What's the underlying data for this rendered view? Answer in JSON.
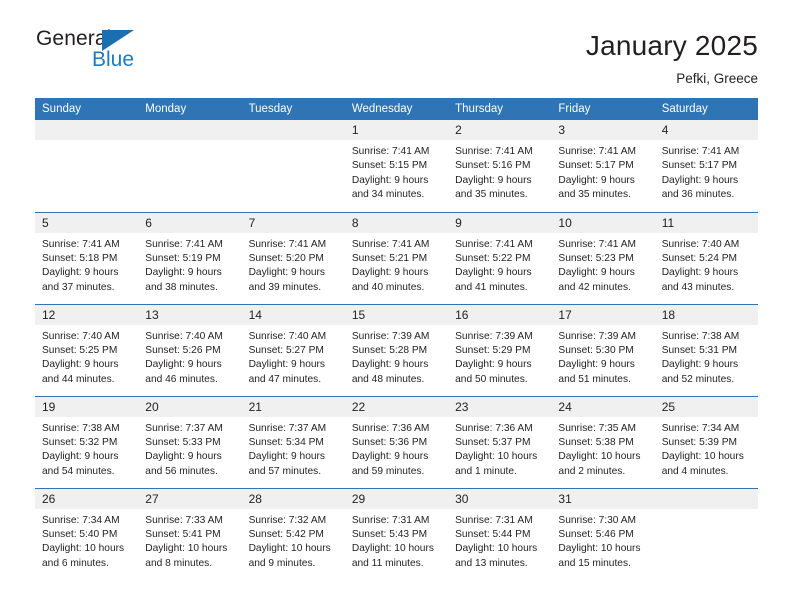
{
  "logo": {
    "word_dark": "General",
    "word_blue": "Blue",
    "triangle_icon": "triangle-icon"
  },
  "header": {
    "title": "January 2025",
    "location": "Pefki, Greece"
  },
  "colors": {
    "header_blue": "#2f74b5",
    "logo_blue": "#1a7dc4",
    "daynum_bg": "#f0f0f0",
    "text": "#231f20"
  },
  "calendar": {
    "weekday_headers": [
      "Sunday",
      "Monday",
      "Tuesday",
      "Wednesday",
      "Thursday",
      "Friday",
      "Saturday"
    ],
    "weeks": [
      [
        {
          "day": "",
          "lines": []
        },
        {
          "day": "",
          "lines": []
        },
        {
          "day": "",
          "lines": []
        },
        {
          "day": "1",
          "lines": [
            "Sunrise: 7:41 AM",
            "Sunset: 5:15 PM",
            "Daylight: 9 hours",
            "and 34 minutes."
          ]
        },
        {
          "day": "2",
          "lines": [
            "Sunrise: 7:41 AM",
            "Sunset: 5:16 PM",
            "Daylight: 9 hours",
            "and 35 minutes."
          ]
        },
        {
          "day": "3",
          "lines": [
            "Sunrise: 7:41 AM",
            "Sunset: 5:17 PM",
            "Daylight: 9 hours",
            "and 35 minutes."
          ]
        },
        {
          "day": "4",
          "lines": [
            "Sunrise: 7:41 AM",
            "Sunset: 5:17 PM",
            "Daylight: 9 hours",
            "and 36 minutes."
          ]
        }
      ],
      [
        {
          "day": "5",
          "lines": [
            "Sunrise: 7:41 AM",
            "Sunset: 5:18 PM",
            "Daylight: 9 hours",
            "and 37 minutes."
          ]
        },
        {
          "day": "6",
          "lines": [
            "Sunrise: 7:41 AM",
            "Sunset: 5:19 PM",
            "Daylight: 9 hours",
            "and 38 minutes."
          ]
        },
        {
          "day": "7",
          "lines": [
            "Sunrise: 7:41 AM",
            "Sunset: 5:20 PM",
            "Daylight: 9 hours",
            "and 39 minutes."
          ]
        },
        {
          "day": "8",
          "lines": [
            "Sunrise: 7:41 AM",
            "Sunset: 5:21 PM",
            "Daylight: 9 hours",
            "and 40 minutes."
          ]
        },
        {
          "day": "9",
          "lines": [
            "Sunrise: 7:41 AM",
            "Sunset: 5:22 PM",
            "Daylight: 9 hours",
            "and 41 minutes."
          ]
        },
        {
          "day": "10",
          "lines": [
            "Sunrise: 7:41 AM",
            "Sunset: 5:23 PM",
            "Daylight: 9 hours",
            "and 42 minutes."
          ]
        },
        {
          "day": "11",
          "lines": [
            "Sunrise: 7:40 AM",
            "Sunset: 5:24 PM",
            "Daylight: 9 hours",
            "and 43 minutes."
          ]
        }
      ],
      [
        {
          "day": "12",
          "lines": [
            "Sunrise: 7:40 AM",
            "Sunset: 5:25 PM",
            "Daylight: 9 hours",
            "and 44 minutes."
          ]
        },
        {
          "day": "13",
          "lines": [
            "Sunrise: 7:40 AM",
            "Sunset: 5:26 PM",
            "Daylight: 9 hours",
            "and 46 minutes."
          ]
        },
        {
          "day": "14",
          "lines": [
            "Sunrise: 7:40 AM",
            "Sunset: 5:27 PM",
            "Daylight: 9 hours",
            "and 47 minutes."
          ]
        },
        {
          "day": "15",
          "lines": [
            "Sunrise: 7:39 AM",
            "Sunset: 5:28 PM",
            "Daylight: 9 hours",
            "and 48 minutes."
          ]
        },
        {
          "day": "16",
          "lines": [
            "Sunrise: 7:39 AM",
            "Sunset: 5:29 PM",
            "Daylight: 9 hours",
            "and 50 minutes."
          ]
        },
        {
          "day": "17",
          "lines": [
            "Sunrise: 7:39 AM",
            "Sunset: 5:30 PM",
            "Daylight: 9 hours",
            "and 51 minutes."
          ]
        },
        {
          "day": "18",
          "lines": [
            "Sunrise: 7:38 AM",
            "Sunset: 5:31 PM",
            "Daylight: 9 hours",
            "and 52 minutes."
          ]
        }
      ],
      [
        {
          "day": "19",
          "lines": [
            "Sunrise: 7:38 AM",
            "Sunset: 5:32 PM",
            "Daylight: 9 hours",
            "and 54 minutes."
          ]
        },
        {
          "day": "20",
          "lines": [
            "Sunrise: 7:37 AM",
            "Sunset: 5:33 PM",
            "Daylight: 9 hours",
            "and 56 minutes."
          ]
        },
        {
          "day": "21",
          "lines": [
            "Sunrise: 7:37 AM",
            "Sunset: 5:34 PM",
            "Daylight: 9 hours",
            "and 57 minutes."
          ]
        },
        {
          "day": "22",
          "lines": [
            "Sunrise: 7:36 AM",
            "Sunset: 5:36 PM",
            "Daylight: 9 hours",
            "and 59 minutes."
          ]
        },
        {
          "day": "23",
          "lines": [
            "Sunrise: 7:36 AM",
            "Sunset: 5:37 PM",
            "Daylight: 10 hours",
            "and 1 minute."
          ]
        },
        {
          "day": "24",
          "lines": [
            "Sunrise: 7:35 AM",
            "Sunset: 5:38 PM",
            "Daylight: 10 hours",
            "and 2 minutes."
          ]
        },
        {
          "day": "25",
          "lines": [
            "Sunrise: 7:34 AM",
            "Sunset: 5:39 PM",
            "Daylight: 10 hours",
            "and 4 minutes."
          ]
        }
      ],
      [
        {
          "day": "26",
          "lines": [
            "Sunrise: 7:34 AM",
            "Sunset: 5:40 PM",
            "Daylight: 10 hours",
            "and 6 minutes."
          ]
        },
        {
          "day": "27",
          "lines": [
            "Sunrise: 7:33 AM",
            "Sunset: 5:41 PM",
            "Daylight: 10 hours",
            "and 8 minutes."
          ]
        },
        {
          "day": "28",
          "lines": [
            "Sunrise: 7:32 AM",
            "Sunset: 5:42 PM",
            "Daylight: 10 hours",
            "and 9 minutes."
          ]
        },
        {
          "day": "29",
          "lines": [
            "Sunrise: 7:31 AM",
            "Sunset: 5:43 PM",
            "Daylight: 10 hours",
            "and 11 minutes."
          ]
        },
        {
          "day": "30",
          "lines": [
            "Sunrise: 7:31 AM",
            "Sunset: 5:44 PM",
            "Daylight: 10 hours",
            "and 13 minutes."
          ]
        },
        {
          "day": "31",
          "lines": [
            "Sunrise: 7:30 AM",
            "Sunset: 5:46 PM",
            "Daylight: 10 hours",
            "and 15 minutes."
          ]
        },
        {
          "day": "",
          "lines": []
        }
      ]
    ]
  }
}
